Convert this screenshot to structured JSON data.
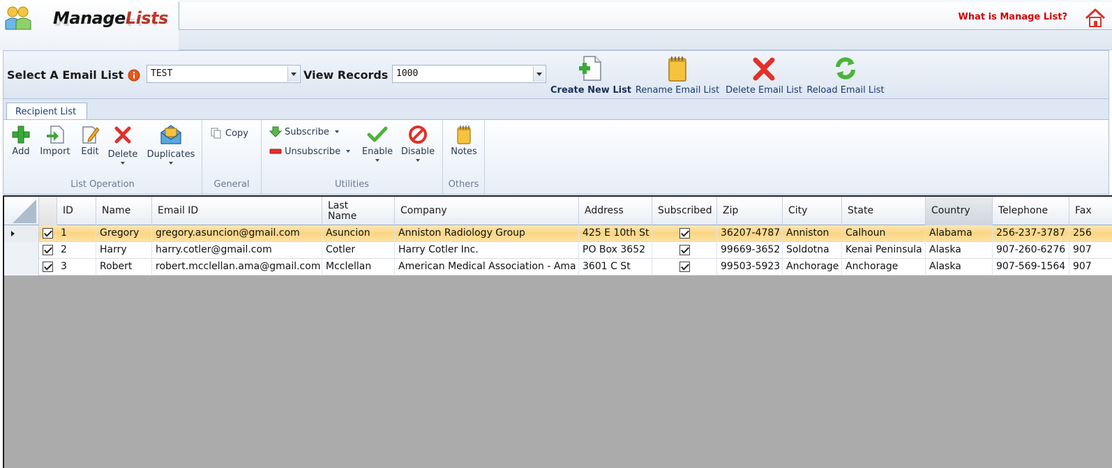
{
  "header": {
    "logo_word1": "Manage",
    "logo_word2": "Lists",
    "help_link": "What is Manage List?",
    "home_icon": "home-icon"
  },
  "selection": {
    "email_list_label": "Select A Email List",
    "email_list_value": "TEST",
    "view_records_label": "View Records",
    "view_records_value": "1000"
  },
  "list_actions": [
    {
      "label": "Create New List",
      "icon": "new-document-icon"
    },
    {
      "label": "Rename Email List",
      "icon": "notepad-icon"
    },
    {
      "label": "Delete Email List",
      "icon": "red-x-icon"
    },
    {
      "label": "Reload Email List",
      "icon": "refresh-icon"
    }
  ],
  "ribbon": {
    "tab": "Recipient List",
    "groups": {
      "list_operation": "List Operation",
      "general": "General",
      "utilities": "Utilities",
      "others": "Others"
    },
    "buttons": {
      "add": "Add",
      "import": "Import",
      "edit": "Edit",
      "delete": "Delete",
      "duplicates": "Duplicates",
      "copy": "Copy",
      "subscribe": "Subscribe",
      "unsubscribe": "Unsubscribe",
      "enable": "Enable",
      "disable": "Disable",
      "notes": "Notes"
    }
  },
  "table": {
    "columns": [
      "ID",
      "Name",
      "Email ID",
      "Last Name",
      "Company",
      "Address",
      "Subscribed",
      "Zip",
      "City",
      "State",
      "Country",
      "Telephone",
      "Fax"
    ],
    "rows": [
      {
        "id": "1",
        "name": "Gregory",
        "email": "gregory.asuncion@gmail.com",
        "last": "Asuncion",
        "company": "Anniston Radiology Group",
        "address": "425 E 10th St",
        "zip": "36207-4787",
        "city": "Anniston",
        "state": "Calhoun",
        "country": "Alabama",
        "telephone": "256-237-3787",
        "fax": "256"
      },
      {
        "id": "2",
        "name": "Harry",
        "email": "harry.cotler@gmail.com",
        "last": "Cotler",
        "company": "Harry Cotler Inc.",
        "address": "PO Box 3652",
        "zip": "99669-3652",
        "city": "Soldotna",
        "state": "Kenai Peninsula",
        "country": "Alaska",
        "telephone": "907-260-6276",
        "fax": "907"
      },
      {
        "id": "3",
        "name": "Robert",
        "email": "robert.mcclellan.ama@gmail.com",
        "last": "Mcclellan",
        "company": "American Medical Association - Ama",
        "address": "3601 C St",
        "zip": "99503-5923",
        "city": "Anchorage",
        "state": "Anchorage",
        "country": "Alaska",
        "telephone": "907-569-1564",
        "fax": "907"
      }
    ]
  },
  "colors": {
    "active_row": "#fbd583",
    "grid_empty": "#ababab",
    "help_link": "#d40000",
    "logo_accent": "#c0392b"
  }
}
